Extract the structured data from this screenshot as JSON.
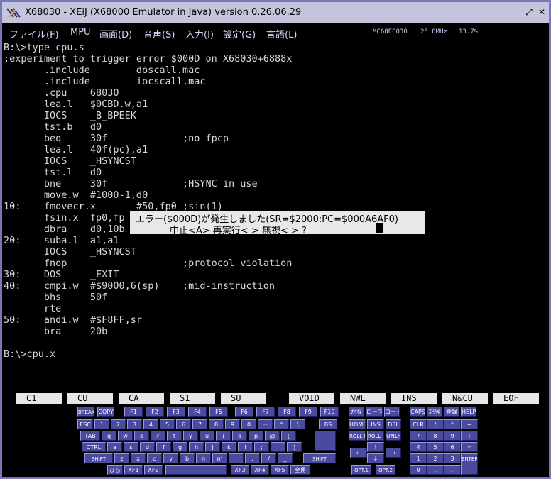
{
  "title": "X68030 - XEiJ (X68000 Emulator in Java) version 0.26.06.29",
  "menu": [
    "ファイル(F)",
    "MPU",
    "画面(D)",
    "音声(S)",
    "入力(I)",
    "設定(G)",
    "言語(L)"
  ],
  "status": {
    "mpu": "MC68EC030",
    "clock": "25.0MHz",
    "load": "13.7%"
  },
  "screen_lines": [
    "B:\\>type cpu.s",
    ";experiment to trigger error $000D on X68030+6888x",
    "       .include        doscall.mac",
    "       .include        iocscall.mac",
    "       .cpu    68030",
    "       lea.l   $0CBD.w,a1",
    "       IOCS    _B_BPEEK",
    "       tst.b   d0",
    "       beq     30f             ;no fpcp",
    "       lea.l   40f(pc),a1",
    "       IOCS    _HSYNCST",
    "       tst.l   d0",
    "       bne     30f             ;HSYNC in use",
    "       move.w  #1000-1,d0",
    "10:    fmovecr.x       #50,fp0 ;sin(1)",
    "       fsin.x  fp0,fp",
    "       dbra    d0,10b",
    "20:    suba.l  a1,a1",
    "       IOCS    _HSYNCST",
    "       fnop                    ;protocol violation",
    "30:    DOS     _EXIT",
    "40:    cmpi.w  #$9000,6(sp)    ;mid-instruction",
    "       bhs     50f",
    "       rte",
    "50:    andi.w  #$F8FF,sr",
    "       bra     20b",
    "",
    "B:\\>cpu.x"
  ],
  "error": {
    "line1": "エラー($000D)が発生しました(SR=$2000:PC=$000A6AF0)",
    "line2": "中止<A> 再実行< > 無視< > ?"
  },
  "fkeys": [
    "C1",
    "CU",
    "CA",
    "S1",
    "SU",
    "VOID",
    "NWL",
    "INS",
    "N&CU",
    "EOF"
  ],
  "keys": {
    "r0": [
      "BREAK",
      "COPY",
      "F1",
      "F2",
      "F3",
      "F4",
      "F5",
      "F6",
      "F7",
      "F8",
      "F9",
      "F10",
      "かな",
      "ローマ",
      "コード",
      "CAPS",
      "記号",
      "登録",
      "HELP"
    ],
    "r1": [
      "ESC",
      "1",
      "2",
      "3",
      "4",
      "5",
      "6",
      "7",
      "8",
      "9",
      "0",
      "ー",
      "^",
      "\\",
      "BS",
      "HOME",
      "INS",
      "DEL",
      "CLR",
      "/",
      "*",
      "−"
    ],
    "r2": [
      "TAB",
      "q",
      "w",
      "e",
      "r",
      "t",
      "y",
      "u",
      "i",
      "o",
      "p",
      "@",
      "[",
      "ROLL UP",
      "ROLL DOWN",
      "UNDO",
      "7",
      "8",
      "9",
      "+"
    ],
    "r3": [
      "CTRL",
      "a",
      "s",
      "d",
      "f",
      "g",
      "h",
      "j",
      "k",
      "l",
      ";",
      ":",
      "]",
      "←",
      "↑",
      "→",
      "4",
      "5",
      "6",
      "="
    ],
    "r4": [
      "SHIFT",
      "z",
      "x",
      "c",
      "v",
      "b",
      "n",
      "m",
      ",",
      ".",
      "/",
      "_",
      "SHIFT",
      "↓",
      "1",
      "2",
      "3",
      "ENTER"
    ],
    "r5": [
      "ひら",
      "XF1",
      "XF2",
      "XF3",
      "XF4",
      "XF5",
      "全角",
      "OPT.1",
      "OPT.2",
      "0",
      ",",
      "."
    ]
  }
}
